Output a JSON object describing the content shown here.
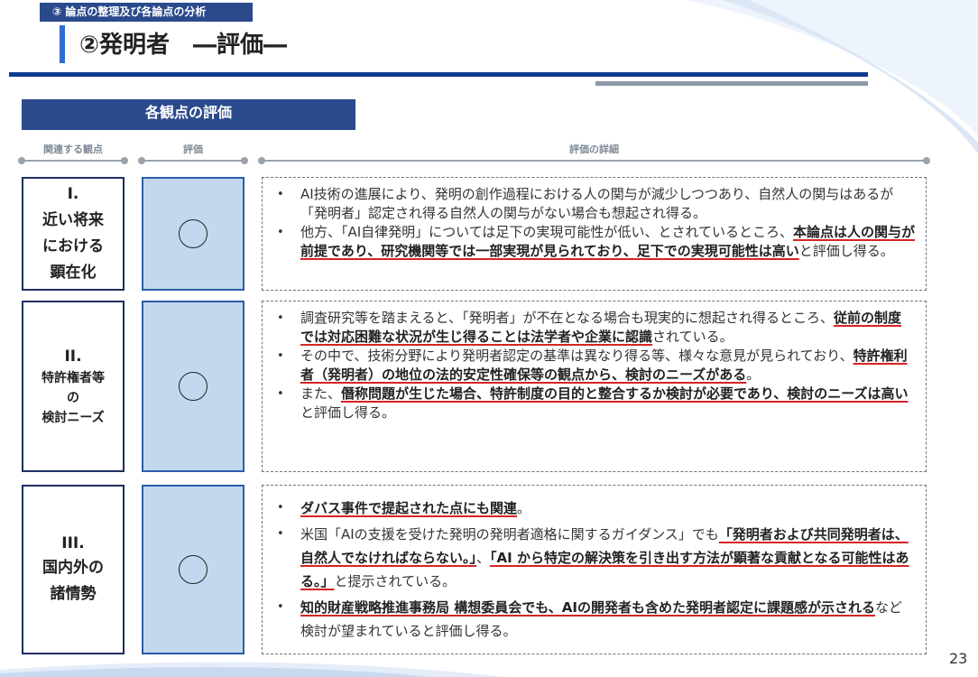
{
  "header": {
    "section_tag": "③ 論点の整理及び各論点の分析",
    "title": "②発明者　―評価―"
  },
  "evaluation": {
    "heading": "各観点の評価",
    "columns": {
      "viewpoint": "関連する観点",
      "rating": "評価",
      "details": "評価の詳細"
    },
    "rows": [
      {
        "label_num": "I.",
        "label_lines": [
          "近い将来",
          "における",
          "顕在化"
        ],
        "rating": "〇",
        "bullets": [
          {
            "parts": [
              {
                "t": "AI技術の進展により、発明の創作過程における人の関与が減少しつつあり、自然人の関与はあるが「発明者」認定され得る自然人の関与がない場合も想起され得る。",
                "em": false
              }
            ]
          },
          {
            "parts": [
              {
                "t": "他方、「AI自律発明」については足下の実現可能性が低い、とされているところ、",
                "em": false
              },
              {
                "t": "本論点は人の関与が前提であり、研究機関等では一部実現が見られており、足下での実現可能性は高い",
                "em": true
              },
              {
                "t": "と評価し得る。",
                "em": false
              }
            ]
          }
        ]
      },
      {
        "label_num": "II.",
        "label_lines": [
          "特許権者等",
          "の",
          "検討ニーズ"
        ],
        "rating": "〇",
        "bullets": [
          {
            "parts": [
              {
                "t": "調査研究等を踏まえると、「発明者」が不在となる場合も現実的に想起され得るところ、",
                "em": false
              },
              {
                "t": "従前の制度では対応困難な状況が生じ得ることは法学者や企業に認識",
                "em": true
              },
              {
                "t": "されている。",
                "em": false
              }
            ]
          },
          {
            "parts": [
              {
                "t": "その中で、技術分野により発明者認定の基準は異なり得る等、様々な意見が見られており、",
                "em": false
              },
              {
                "t": "特許権利者（発明者）の地位の法的安定性確保等の観点から、検討のニーズがある",
                "em": true
              },
              {
                "t": "。",
                "em": false
              }
            ]
          },
          {
            "parts": [
              {
                "t": "また、",
                "em": false
              },
              {
                "t": "僭称問題が生じた場合、特許制度の目的と整合するか検討が必要であり、検討のニーズは高い",
                "em": true
              },
              {
                "t": "と評価し得る。",
                "em": false
              }
            ]
          }
        ]
      },
      {
        "label_num": "III.",
        "label_lines": [
          "国内外の",
          "諸情勢"
        ],
        "rating": "〇",
        "bullets": [
          {
            "parts": [
              {
                "t": "ダバス事件で提起された点にも関連",
                "em": true
              },
              {
                "t": "。",
                "em": false
              }
            ]
          },
          {
            "parts": [
              {
                "t": "米国「AIの支援を受けた発明の発明者適格に関するガイダンス」でも",
                "em": false
              },
              {
                "t": "「発明者および共同発明者は、自然人でなければならない。」",
                "em": true
              },
              {
                "t": "、",
                "em": false
              },
              {
                "t": "「AI から特定の解決策を引き出す方法が顕著な貢献となる可能性はある。」",
                "em": true
              },
              {
                "t": "と提示されている。",
                "em": false
              }
            ]
          },
          {
            "parts": [
              {
                "t": "知的財産戦略推進事務局 構想委員会でも、AIの開発者も含めた発明者認定に課題感が示される",
                "em": true
              },
              {
                "t": "など検討が望まれていると評価し得る。",
                "em": false
              }
            ]
          }
        ]
      }
    ]
  },
  "page_number": "23",
  "colors": {
    "navy": "#2a4a8c",
    "rule_blue": "#0d3b8f",
    "rule_gray": "#8d99a8",
    "eval_fill": "#c3d8ef",
    "underline_red": "#d62424"
  }
}
